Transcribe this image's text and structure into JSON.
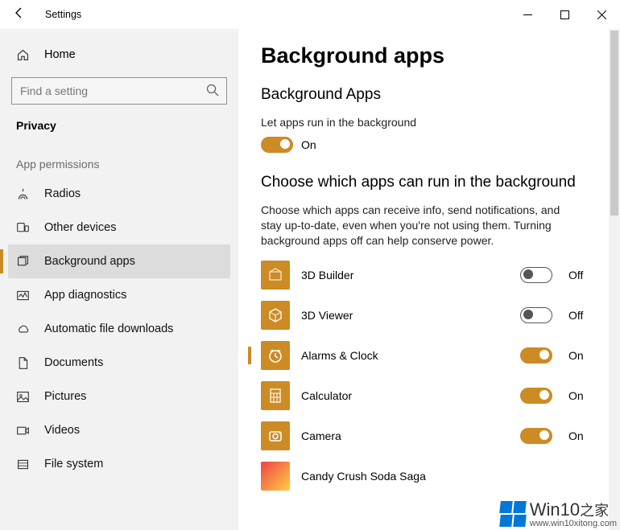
{
  "window": {
    "title": "Settings",
    "home_label": "Home",
    "search_placeholder": "Find a setting",
    "section": "Privacy",
    "group": "App permissions"
  },
  "nav": [
    {
      "label": "Radios",
      "icon": "radios"
    },
    {
      "label": "Other devices",
      "icon": "devices"
    },
    {
      "label": "Background apps",
      "icon": "bgapps",
      "selected": true
    },
    {
      "label": "App diagnostics",
      "icon": "diag"
    },
    {
      "label": "Automatic file downloads",
      "icon": "cloud"
    },
    {
      "label": "Documents",
      "icon": "doc"
    },
    {
      "label": "Pictures",
      "icon": "pic"
    },
    {
      "label": "Videos",
      "icon": "vid"
    },
    {
      "label": "File system",
      "icon": "fs"
    }
  ],
  "main": {
    "page_title": "Background apps",
    "sub_title": "Background Apps",
    "master_label": "Let apps run in the background",
    "master_state": "On",
    "choose_title": "Choose which apps can run in the background",
    "choose_desc": "Choose which apps can receive info, send notifications, and stay up-to-date, even when you're not using them. Turning background apps off can help conserve power.",
    "apps": [
      {
        "name": "3D Builder",
        "state": "Off"
      },
      {
        "name": "3D Viewer",
        "state": "Off"
      },
      {
        "name": "Alarms & Clock",
        "state": "On",
        "marker": true
      },
      {
        "name": "Calculator",
        "state": "On"
      },
      {
        "name": "Camera",
        "state": "On"
      },
      {
        "name": "Candy Crush Soda Saga",
        "state": "",
        "img": true
      }
    ]
  },
  "watermark": {
    "brand": "Win10",
    "suffix": "之家",
    "url": "www.win10xitong.com"
  }
}
